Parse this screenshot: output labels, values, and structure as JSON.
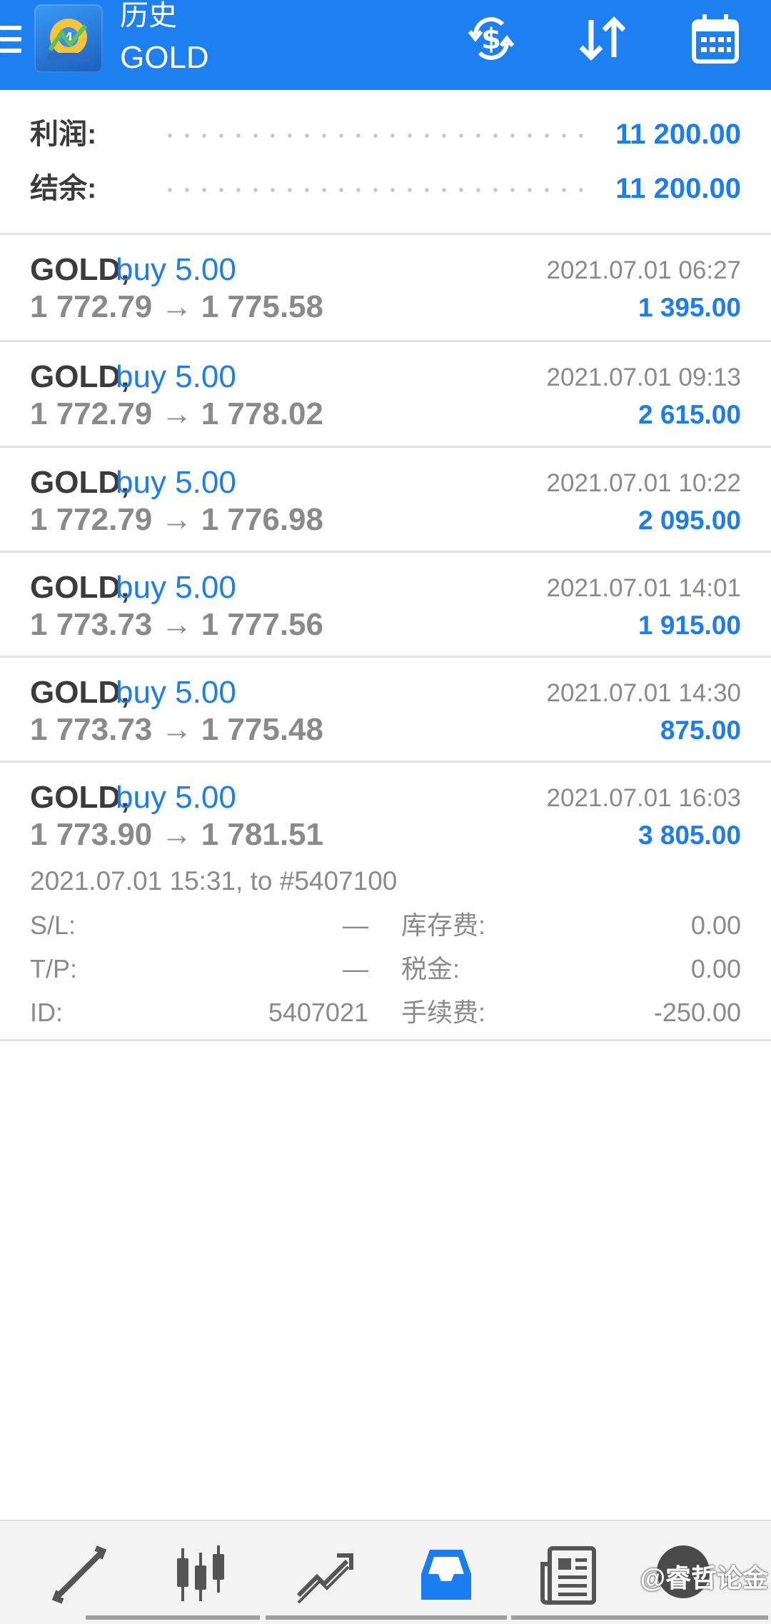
{
  "header": {
    "title": "历史",
    "subtitle": "GOLD"
  },
  "summary": {
    "profit_label": "利润:",
    "profit_value": "11 200.00",
    "balance_label": "结余:",
    "balance_value": "11 200.00"
  },
  "trades": [
    {
      "symbol": "GOLD,",
      "type": "buy 5.00",
      "prices": "1 772.79 → 1 775.58",
      "time": "2021.07.01 06:27",
      "profit": "1 395.00"
    },
    {
      "symbol": "GOLD,",
      "type": "buy 5.00",
      "prices": "1 772.79 → 1 778.02",
      "time": "2021.07.01 09:13",
      "profit": "2 615.00"
    },
    {
      "symbol": "GOLD,",
      "type": "buy 5.00",
      "prices": "1 772.79 → 1 776.98",
      "time": "2021.07.01 10:22",
      "profit": "2 095.00"
    },
    {
      "symbol": "GOLD,",
      "type": "buy 5.00",
      "prices": "1 773.73 → 1 777.56",
      "time": "2021.07.01 14:01",
      "profit": "1 915.00"
    },
    {
      "symbol": "GOLD,",
      "type": "buy 5.00",
      "prices": "1 773.73 → 1 775.48",
      "time": "2021.07.01 14:30",
      "profit": "875.00"
    },
    {
      "symbol": "GOLD,",
      "type": "buy 5.00",
      "prices": "1 773.90 → 1 781.51",
      "time": "2021.07.01 16:03",
      "profit": "3 805.00"
    }
  ],
  "expanded": {
    "open_info": "2021.07.01 15:31, to #5407100",
    "sl_label": "S/L:",
    "sl_value": "—",
    "tp_label": "T/P:",
    "tp_value": "—",
    "id_label": "ID:",
    "id_value": "5407021",
    "swap_label": "库存费:",
    "swap_value": "0.00",
    "tax_label": "税金:",
    "tax_value": "0.00",
    "commission_label": "手续费:",
    "commission_value": "-250.00"
  },
  "bottom_nav": {
    "items": [
      "quotes-icon",
      "chart-icon",
      "trade-icon",
      "history-icon",
      "news-icon"
    ],
    "active": "history-icon",
    "watermark": "@睿哲论金"
  },
  "colors": {
    "header_bg": "#1e7ff0",
    "accent": "#1a7ef0",
    "muted": "#8a8a8a"
  }
}
